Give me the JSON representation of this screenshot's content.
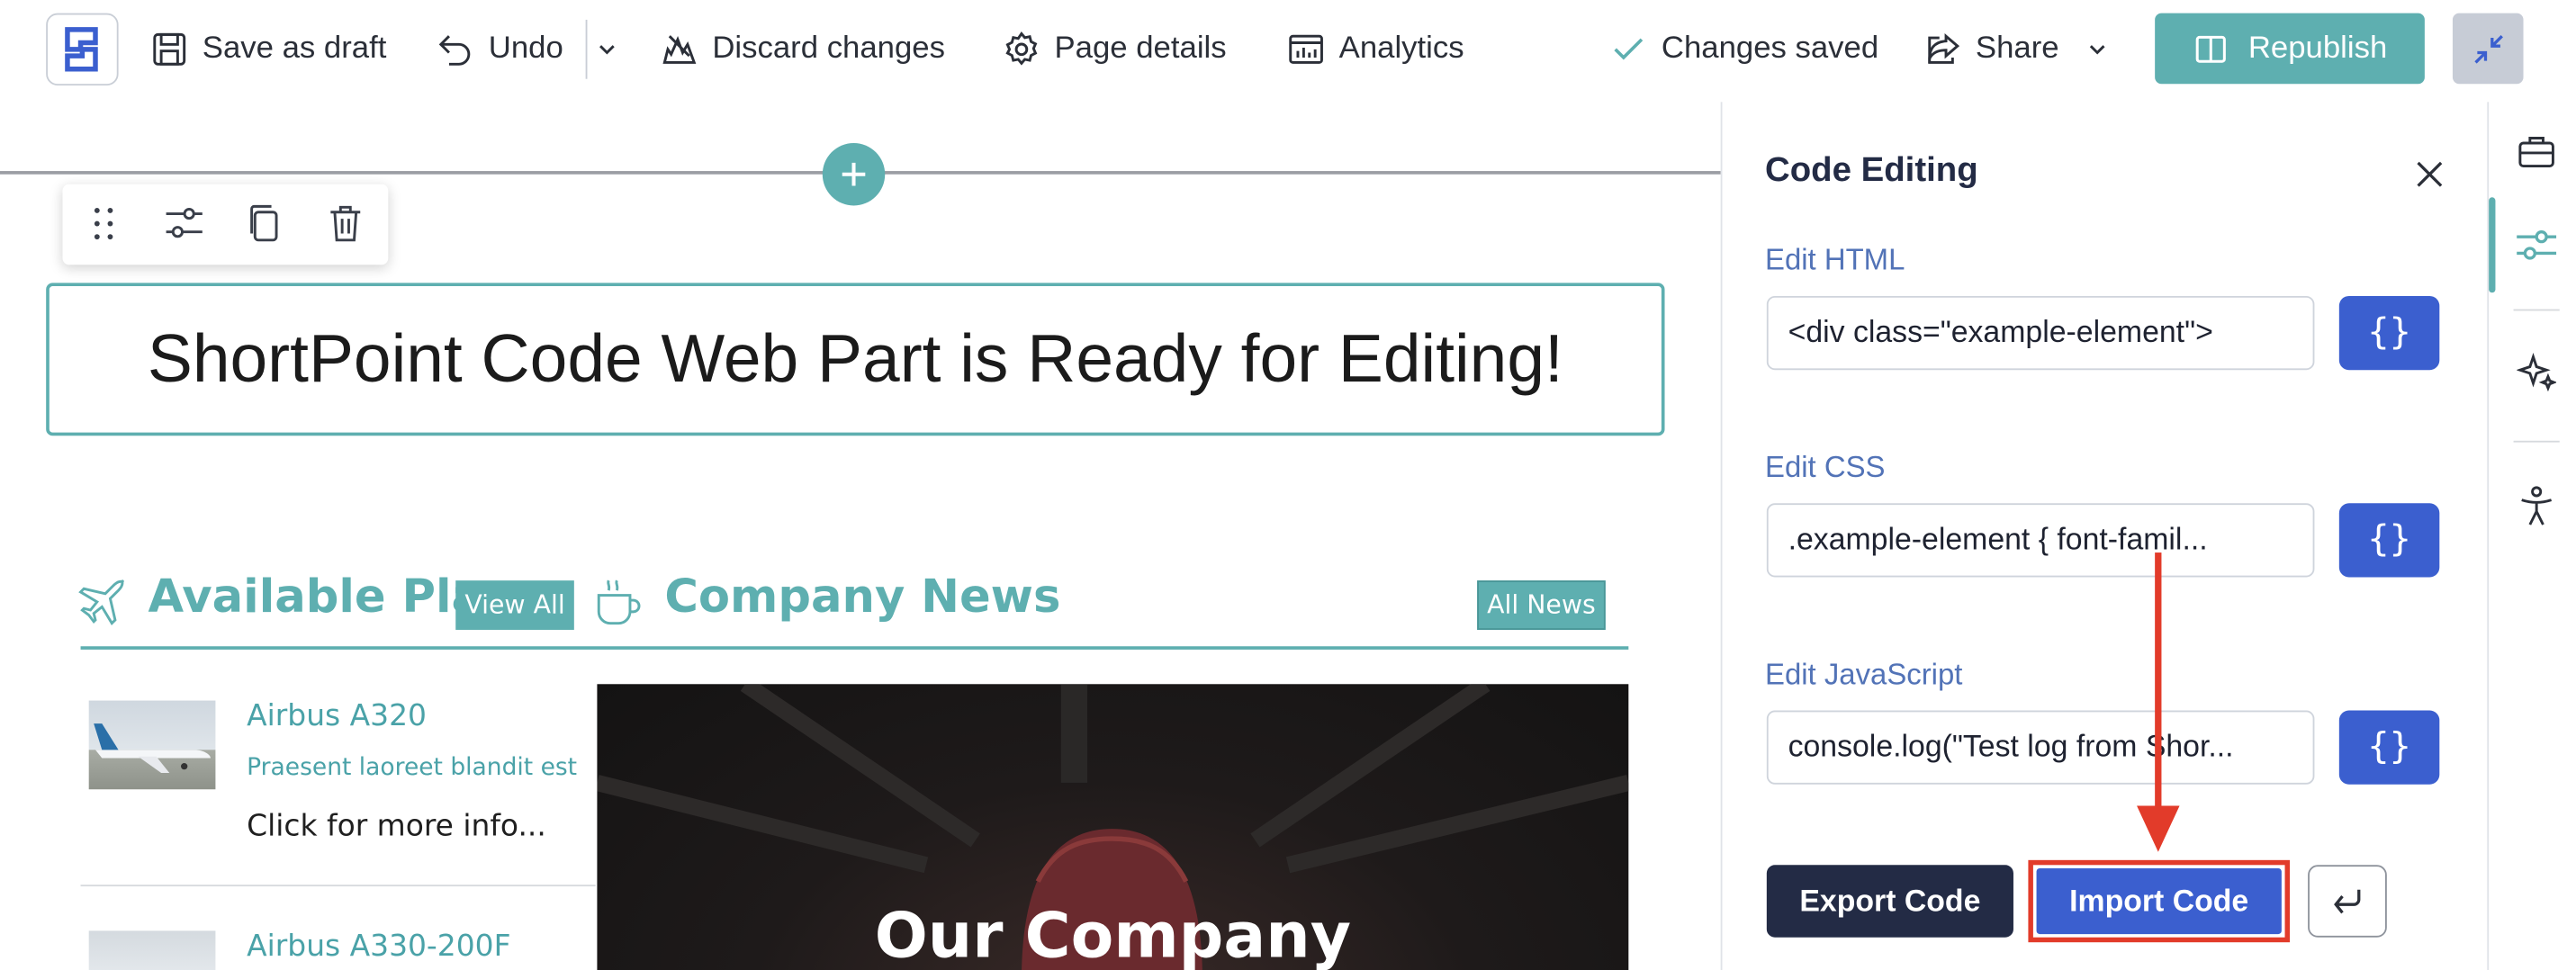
{
  "toolbar": {
    "save_draft": "Save as draft",
    "undo": "Undo",
    "discard": "Discard changes",
    "page_details": "Page details",
    "analytics": "Analytics",
    "status": "Changes saved",
    "share": "Share",
    "republish": "Republish"
  },
  "canvas": {
    "headline": "ShortPoint Code Web Part is Ready for Editing!",
    "planes_title": "Available Plane",
    "view_all": "View All",
    "news_title": "Company News",
    "all_news": "All News",
    "planes": [
      {
        "name": "Airbus A320",
        "subtitle": "Praesent laoreet blandit est",
        "more": "Click for more info..."
      },
      {
        "name": "Airbus A330-200F"
      }
    ],
    "news_overlay": "Our Company"
  },
  "panel": {
    "title": "Code Editing",
    "html_label": "Edit HTML",
    "html_value": "<div class=\"example-element\">",
    "css_label": "Edit CSS",
    "css_value": ".example-element {    font-famil...",
    "js_label": "Edit JavaScript",
    "js_value": "console.log(\"Test log from Shor...",
    "brace": "{}",
    "export": "Export Code",
    "import": "Import Code"
  },
  "colors": {
    "teal": "#5eafb0",
    "accent_blue": "#3b5fcf",
    "navy": "#232b45",
    "highlight_red": "#e23b2a"
  }
}
